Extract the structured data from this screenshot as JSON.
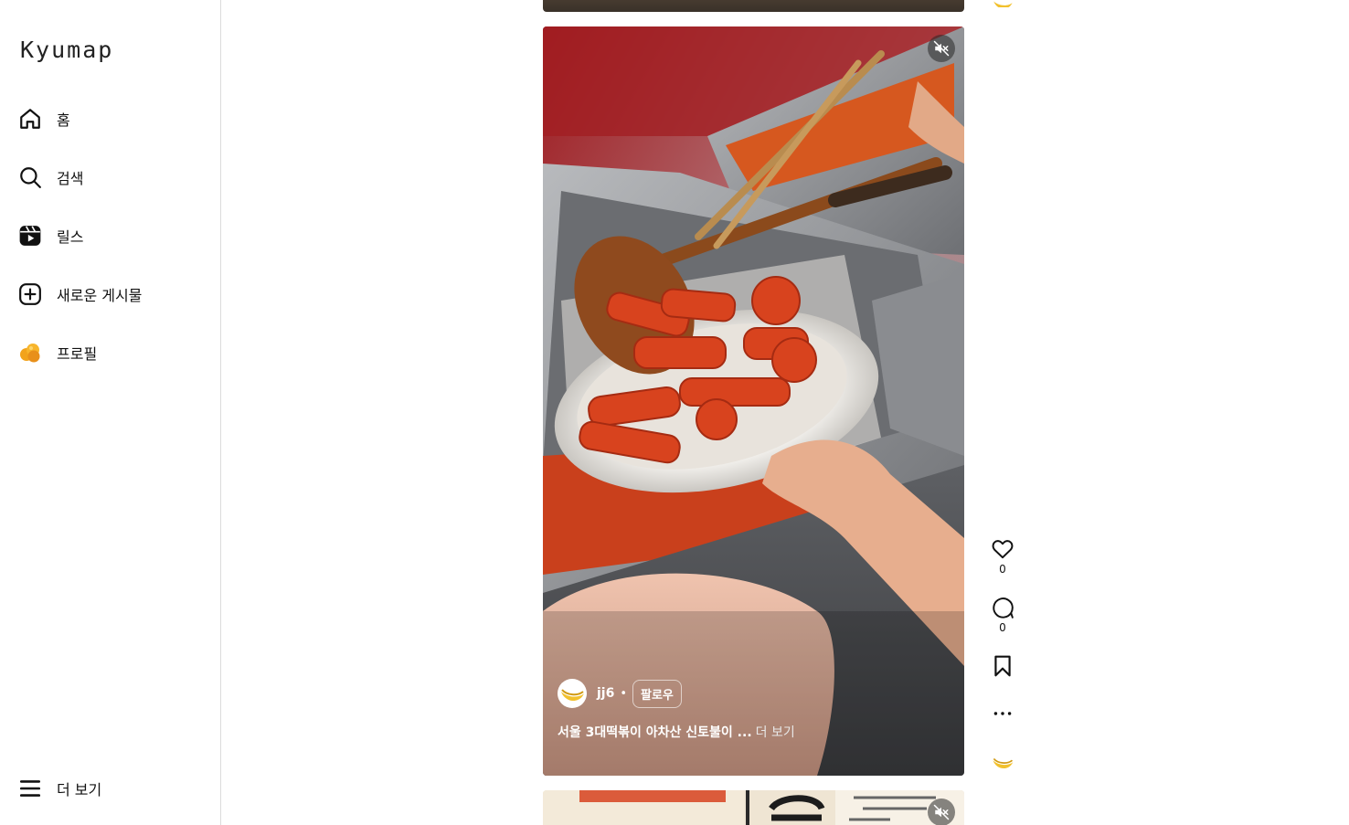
{
  "app": {
    "logo": "Kyumap"
  },
  "sidebar": {
    "items": [
      {
        "label": "홈",
        "icon": "home-icon"
      },
      {
        "label": "검색",
        "icon": "search-icon"
      },
      {
        "label": "릴스",
        "icon": "reels-icon"
      },
      {
        "label": "새로운 게시물",
        "icon": "plus-square-icon"
      },
      {
        "label": "프로필",
        "icon": "profile-avatar"
      }
    ],
    "more_label": "더 보기"
  },
  "reel": {
    "username": "jj6",
    "separator": "•",
    "follow_label": "팔로우",
    "caption": "서울 3대떡볶이 아차산 신토불이 ...",
    "more_label": "더 보기",
    "likes": "0",
    "comments": "0",
    "muted": true
  },
  "colors": {
    "accent": "#0095f6",
    "border": "#dbdbdb",
    "sauce": "#d8431e"
  }
}
